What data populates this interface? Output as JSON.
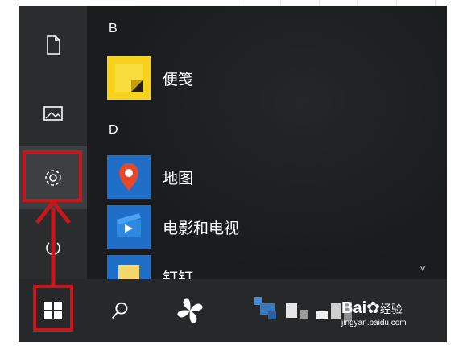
{
  "start_menu": {
    "sections": [
      {
        "letter": "B",
        "apps": [
          {
            "name": "便笺",
            "icon": "sticky-notes-icon"
          }
        ]
      },
      {
        "letter": "D",
        "apps": [
          {
            "name": "地图",
            "icon": "maps-icon"
          },
          {
            "name": "电影和电视",
            "icon": "movies-tv-icon"
          },
          {
            "name": "钉钉",
            "icon": "dingtalk-icon"
          }
        ]
      }
    ],
    "rail": [
      "document-icon",
      "pictures-icon",
      "settings-icon",
      "power-icon"
    ],
    "scroll_indicator": "˅"
  },
  "taskbar": {
    "items": [
      "windows-start-icon",
      "search-icon",
      "pinwheel-app-icon",
      "pixelated-app-icons"
    ]
  },
  "watermark": {
    "brand": "Bai",
    "suffix": "经验",
    "url": "jingyan.baidu.com"
  },
  "colors": {
    "highlight": "#c8161d",
    "tile_blue": "#1f6fc8",
    "sticky_yellow": "#f7d21c"
  }
}
